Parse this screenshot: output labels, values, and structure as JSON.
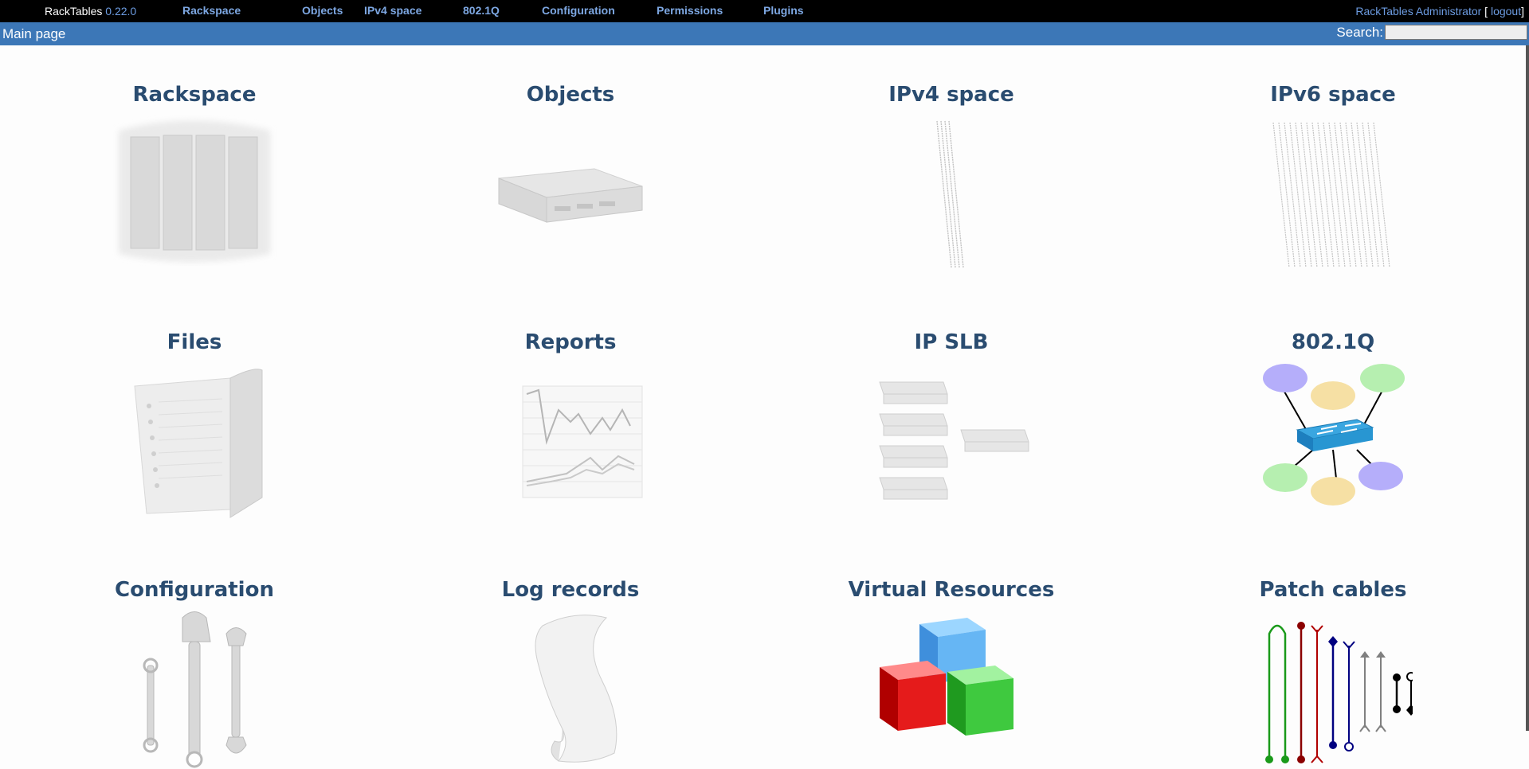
{
  "header": {
    "app_name": "RackTables",
    "version": "0.22.0",
    "user_name": "RackTables Administrator",
    "logout_label": "logout",
    "user_open": "[",
    "user_close": "]"
  },
  "nav": [
    "Rackspace",
    "Objects",
    "IPv4 space",
    "802.1Q",
    "Configuration",
    "Permissions",
    "Plugins"
  ],
  "breadcrumb": "Main page",
  "search": {
    "label": "Search:",
    "value": ""
  },
  "tiles": [
    {
      "label": "Rackspace",
      "icon": "rack-icon"
    },
    {
      "label": "Objects",
      "icon": "server-icon"
    },
    {
      "label": "IPv4 space",
      "icon": "ipv4-icon"
    },
    {
      "label": "IPv6 space",
      "icon": "ipv6-icon"
    },
    {
      "label": "Files",
      "icon": "folder-icon"
    },
    {
      "label": "Reports",
      "icon": "report-chart-icon"
    },
    {
      "label": "IP SLB",
      "icon": "load-balancer-icon"
    },
    {
      "label": "802.1Q",
      "icon": "vlan-switch-icon"
    },
    {
      "label": "Configuration",
      "icon": "wrench-icon"
    },
    {
      "label": "Log records",
      "icon": "scroll-icon"
    },
    {
      "label": "Virtual Resources",
      "icon": "cubes-icon"
    },
    {
      "label": "Patch cables",
      "icon": "patch-cables-icon"
    }
  ],
  "colors": {
    "topbar": "#000000",
    "subbar": "#3c77b7",
    "link": "#7da7e2",
    "tile_title": "#2a4c70"
  }
}
